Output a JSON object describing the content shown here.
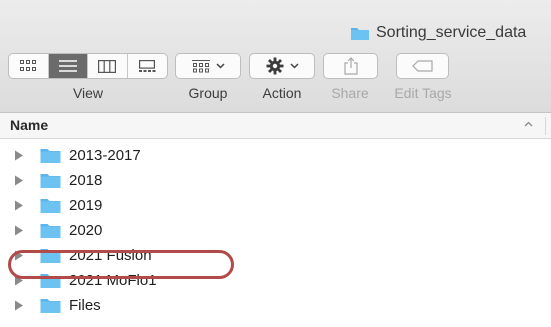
{
  "window": {
    "title": "Sorting_service_data"
  },
  "toolbar": {
    "view_label": "View",
    "group_label": "Group",
    "action_label": "Action",
    "share_label": "Share",
    "edit_tags_label": "Edit Tags",
    "view_modes": [
      "icon-view",
      "list-view",
      "column-view",
      "gallery-view"
    ],
    "selected_view": "list-view"
  },
  "columns": {
    "name_header": "Name",
    "sort_direction": "ascending"
  },
  "files": [
    {
      "name": "2013-2017",
      "type": "folder",
      "expanded": false
    },
    {
      "name": "2018",
      "type": "folder",
      "expanded": false
    },
    {
      "name": "2019",
      "type": "folder",
      "expanded": false
    },
    {
      "name": "2020",
      "type": "folder",
      "expanded": false
    },
    {
      "name": "2021 Fusion",
      "type": "folder",
      "expanded": false,
      "circled": true
    },
    {
      "name": "2021 MoFlo1",
      "type": "folder",
      "expanded": false
    },
    {
      "name": "Files",
      "type": "folder",
      "expanded": false
    }
  ],
  "colors": {
    "folder_blue": "#5ab6ea",
    "highlight_ring": "#b34a4a",
    "selected_view_bg": "#6b6b6b"
  }
}
